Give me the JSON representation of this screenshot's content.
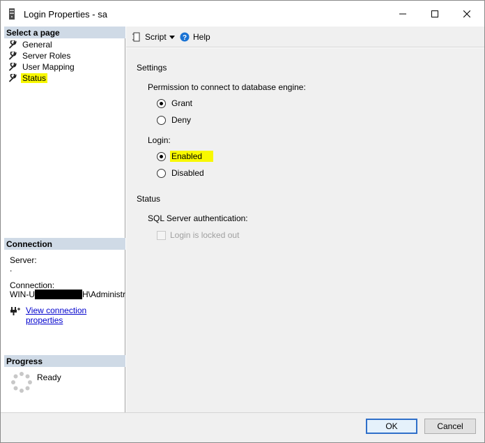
{
  "window": {
    "title": "Login Properties - sa"
  },
  "left_panel": {
    "select_page_header": "Select a page",
    "pages": [
      {
        "label": "General",
        "icon": "wrench-icon"
      },
      {
        "label": "Server Roles",
        "icon": "wrench-icon"
      },
      {
        "label": "User Mapping",
        "icon": "wrench-icon"
      },
      {
        "label": "Status",
        "icon": "wrench-icon",
        "selected": true
      }
    ],
    "connection_header": "Connection",
    "server_label": "Server:",
    "server_value": ".",
    "connection_label": "Connection:",
    "connection_value": "WIN-U████████H\\Administrato",
    "view_connection_link": "View connection properties",
    "progress_header": "Progress",
    "progress_status": "Ready"
  },
  "toolbar": {
    "script_label": "Script",
    "help_label": "Help"
  },
  "main": {
    "settings_heading": "Settings",
    "permission_label": "Permission to connect to database engine:",
    "permission_options": [
      {
        "label": "Grant",
        "checked": true
      },
      {
        "label": "Deny",
        "checked": false
      }
    ],
    "login_label": "Login:",
    "login_options": [
      {
        "label": "Enabled",
        "checked": true
      },
      {
        "label": "Disabled",
        "checked": false
      }
    ],
    "status_heading": "Status",
    "sql_auth_label": "SQL Server authentication:",
    "locked_out_label": "Login is locked out"
  },
  "buttons": {
    "ok": "OK",
    "cancel": "Cancel"
  },
  "colors": {
    "highlight": "#f8f800",
    "section_header_bg": "#cfdae6",
    "link": "#0000cc",
    "help_icon_blue": "#1a73d4"
  }
}
